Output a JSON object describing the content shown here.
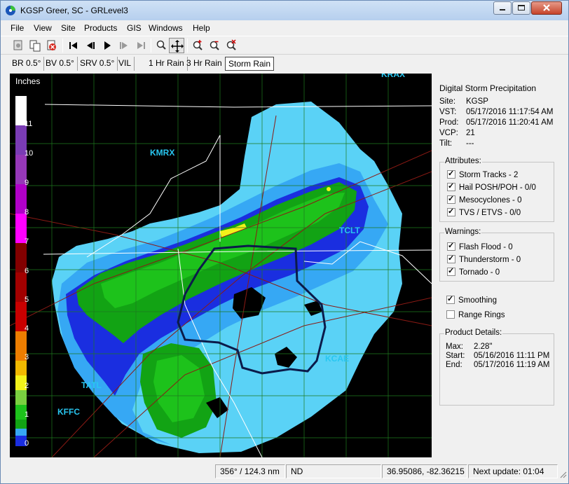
{
  "window": {
    "title": "KGSP Greer, SC - GRLevel3"
  },
  "menu": [
    "File",
    "View",
    "Site",
    "Products",
    "GIS",
    "Windows",
    "Help"
  ],
  "toolbar_icons": [
    "new-window-icon",
    "copy-icon",
    "delete-icon",
    "skip-to-start-icon",
    "step-back-icon",
    "play-icon",
    "step-forward-icon",
    "skip-to-end-icon",
    "magnifier-icon",
    "pan-icon",
    "zoom-in-icon",
    "zoom-out-icon",
    "zoom-reset-icon"
  ],
  "tabs": [
    "BR 0.5°",
    "BV 0.5°",
    "SRV 0.5°",
    "VIL",
    "1 Hr Rain",
    "3 Hr Rain",
    "Storm Rain"
  ],
  "active_tab": "Storm Rain",
  "legend": {
    "title": "Inches",
    "labels": [
      "11",
      "10",
      "9",
      "8",
      "7",
      "6",
      "5",
      "4",
      "3",
      "2",
      "1",
      "0"
    ]
  },
  "radar_sites": [
    "KMRX",
    "KGSP",
    "KFFC",
    "KCAE",
    "KRAX",
    "TCLT",
    "TATL"
  ],
  "radar_sites_visible": [
    "KMRX",
    "KFFC",
    "KCAE",
    "TCLT",
    "TATL",
    "KRAX"
  ],
  "colors": {
    "scale": [
      "#1a2ee0",
      "#2a66f0",
      "#36a8f4",
      "#5ad2f6",
      "#12a314",
      "#1dc21b",
      "#7ad040",
      "#f2f21a",
      "#f0b800",
      "#ec7d00",
      "#c80000",
      "#a20000",
      "#820000",
      "#ff00ff",
      "#b000c8",
      "#7a3cb4",
      "#ffffff"
    ],
    "radar_label": "#28c6f0",
    "boundary": "#ffffff",
    "roads": "#8b1a14",
    "counties": "#1e7a1e"
  },
  "product": {
    "title": "Digital Storm Precipitation",
    "site_key": "Site:",
    "site": "KGSP",
    "vst_key": "VST:",
    "vst": "05/17/2016  11:17:54 AM",
    "prod_key": "Prod:",
    "prod": "05/17/2016  11:20:41 AM",
    "vcp_key": "VCP:",
    "vcp": "21",
    "tilt_key": "Tilt:",
    "tilt": "---"
  },
  "attributes": {
    "label": "Attributes:",
    "items": [
      {
        "label": "Storm Tracks - 2",
        "checked": true
      },
      {
        "label": "Hail POSH/POH - 0/0",
        "checked": true
      },
      {
        "label": "Mesocyclones - 0",
        "checked": true
      },
      {
        "label": "TVS / ETVS - 0/0",
        "checked": true
      }
    ]
  },
  "warnings": {
    "label": "Warnings:",
    "items": [
      {
        "label": "Flash Flood - 0",
        "checked": true
      },
      {
        "label": "Thunderstorm - 0",
        "checked": true
      },
      {
        "label": "Tornado - 0",
        "checked": true
      }
    ]
  },
  "options": [
    {
      "label": "Smoothing",
      "checked": true
    },
    {
      "label": "Range Rings",
      "checked": false
    }
  ],
  "details": {
    "label": "Product Details:",
    "max_key": "Max:",
    "max": "2.28\"",
    "start_key": "Start:",
    "start": "05/16/2016  11:11 PM",
    "end_key": "End:",
    "end": "05/17/2016  11:19 AM"
  },
  "status": {
    "bearing": "356° / 124.3 nm",
    "value": "ND",
    "coords": "36.95086, -82.36215",
    "next_update": "Next update: 01:04"
  }
}
